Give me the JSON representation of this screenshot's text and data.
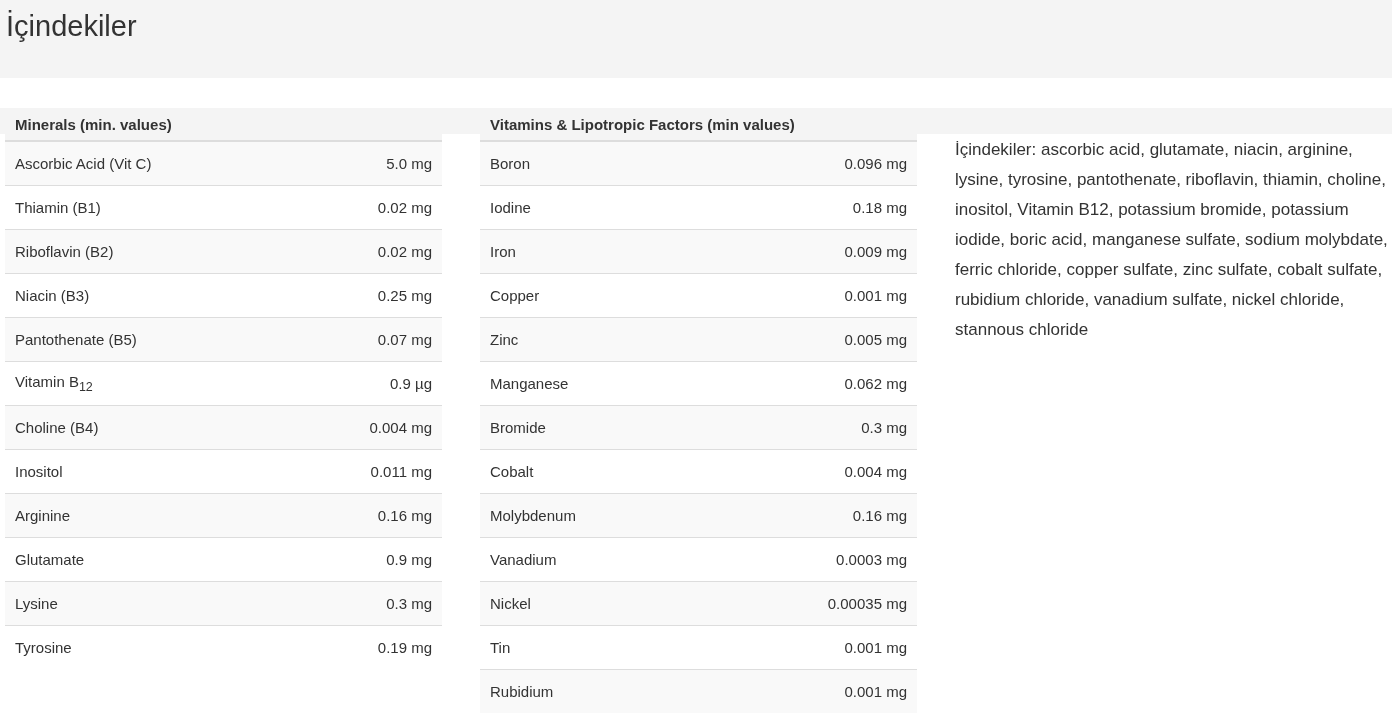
{
  "page": {
    "title": "İçindekiler"
  },
  "tables": [
    {
      "heading": "Minerals (min. values)",
      "rows": [
        {
          "name": "Ascorbic Acid (Vit C)",
          "amount": "5.0 mg"
        },
        {
          "name": "Thiamin (B1)",
          "amount": "0.02 mg"
        },
        {
          "name": "Riboflavin (B2)",
          "amount": "0.02 mg"
        },
        {
          "name": "Niacin (B3)",
          "amount": "0.25 mg"
        },
        {
          "name": "Pantothenate (B5)",
          "amount": "0.07 mg"
        },
        {
          "name": "Vitamin B$_{12}$",
          "amount": "0.9 µg"
        },
        {
          "name": "Choline (B4)",
          "amount": "0.004 mg"
        },
        {
          "name": "Inositol",
          "amount": "0.011 mg"
        },
        {
          "name": "Arginine",
          "amount": "0.16 mg"
        },
        {
          "name": "Glutamate",
          "amount": "0.9 mg"
        },
        {
          "name": "Lysine",
          "amount": "0.3 mg"
        },
        {
          "name": "Tyrosine",
          "amount": "0.19 mg"
        }
      ]
    },
    {
      "heading": "Vitamins & Lipotropic Factors (min values)",
      "rows": [
        {
          "name": "Boron",
          "amount": "0.096 mg"
        },
        {
          "name": "Iodine",
          "amount": "0.18 mg"
        },
        {
          "name": "Iron",
          "amount": "0.009 mg"
        },
        {
          "name": "Copper",
          "amount": "0.001 mg"
        },
        {
          "name": "Zinc",
          "amount": "0.005 mg"
        },
        {
          "name": "Manganese",
          "amount": "0.062 mg"
        },
        {
          "name": "Bromide",
          "amount": "0.3 mg"
        },
        {
          "name": "Cobalt",
          "amount": "0.004 mg"
        },
        {
          "name": "Molybdenum",
          "amount": "0.16 mg"
        },
        {
          "name": "Vanadium",
          "amount": "0.0003 mg"
        },
        {
          "name": "Nickel",
          "amount": "0.00035 mg"
        },
        {
          "name": "Tin",
          "amount": "0.001 mg"
        },
        {
          "name": "Rubidium",
          "amount": "0.001 mg"
        }
      ]
    }
  ],
  "ingredients": "İçindekiler: ascorbic acid, glutamate, niacin, arginine, lysine, tyrosine, pantothenate, riboflavin, thiamin, choline, inositol, Vitamin B12, potassium bromide, potassium iodide, boric acid, manganese sulfate, sodium molybdate, ferric chloride, copper sulfate, zinc sulfate, cobalt sulfate, rubidium chloride, vanadium sulfate, nickel chloride, stannous chloride"
}
